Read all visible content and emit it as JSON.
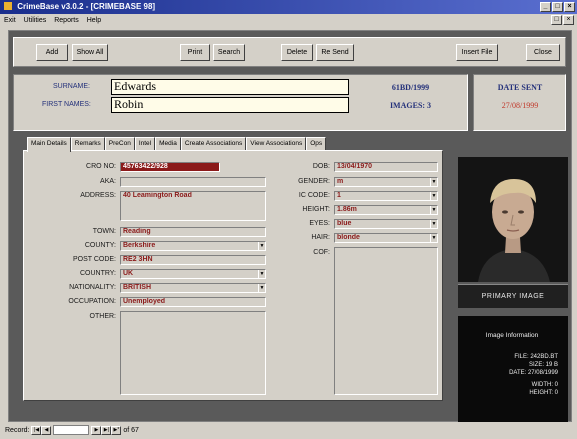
{
  "window": {
    "title": "CrimeBase v3.0.2 - [CRIMEBASE 98]"
  },
  "menu": [
    "Exit",
    "Utilities",
    "Reports",
    "Help"
  ],
  "toolbar": {
    "add": "Add",
    "show_all": "Show All",
    "print": "Print",
    "search": "Search",
    "delete": "Delete",
    "resend": "Re Send",
    "insert_file": "Insert File",
    "close": "Close"
  },
  "header": {
    "surname_label": "SURNAME:",
    "surname": "Edwards",
    "first_names_label": "FIRST NAMES:",
    "first_names": "Robin",
    "case_ref": "61BD/1999",
    "images": "IMAGES: 3",
    "date_sent_label": "DATE SENT",
    "date_sent": "27/08/1999"
  },
  "tabs": [
    "Main Details",
    "Remarks",
    "PreCon",
    "Intel",
    "Media",
    "Create Associations",
    "View Associations",
    "Ops"
  ],
  "details": {
    "cro_no_label": "CRO NO:",
    "cro_no": "45763422/928",
    "aka_label": "AKA:",
    "aka": "",
    "address_label": "ADDRESS:",
    "address": "40 Leamington Road",
    "town_label": "TOWN:",
    "town": "Reading",
    "county_label": "COUNTY:",
    "county": "Berkshire",
    "post_code_label": "POST CODE:",
    "post_code": "RE2 3HN",
    "country_label": "COUNTRY:",
    "country": "UK",
    "nationality_label": "NATIONALITY:",
    "nationality": "BRITISH",
    "occupation_label": "OCCUPATION:",
    "occupation": "Unemployed",
    "other_label": "OTHER:",
    "other": "",
    "dob_label": "DOB:",
    "dob": "13/04/1970",
    "gender_label": "GENDER:",
    "gender": "m",
    "ic_code_label": "IC CODE:",
    "ic_code": "1",
    "height_label": "HEIGHT:",
    "height": "1.86m",
    "eyes_label": "EYES:",
    "eyes": "blue",
    "hair_label": "HAIR:",
    "hair": "blonde",
    "cof_label": "COF:",
    "cof": ""
  },
  "image_panel": {
    "primary_label": "PRIMARY IMAGE",
    "info_title": "Image Information",
    "file": "FILE: 242BD.BT",
    "size": "SIZE: 19 B",
    "date": "DATE: 27/08/1999",
    "width": "WIDTH: 0",
    "height": "HEIGHT: 0"
  },
  "record_nav": {
    "label": "Record:",
    "of": "of 67"
  },
  "colors": {
    "title_bar": "#1a2e8c",
    "field_text": "#8b1a1a",
    "accent_text": "#23307a"
  }
}
